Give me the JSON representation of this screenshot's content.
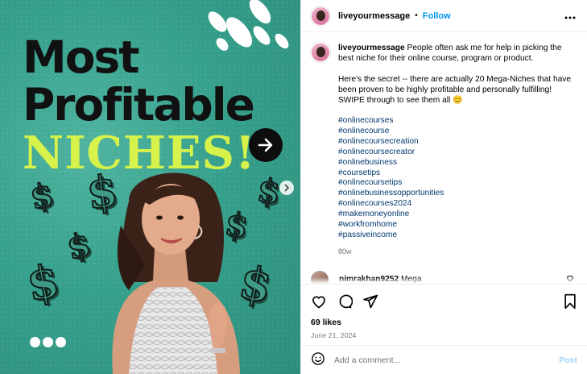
{
  "media": {
    "headline_line1": "Most",
    "headline_line2": "Profitable",
    "headline_line3": "NICHES!",
    "dollar_glyph": "$",
    "colors": {
      "background": "#35a08b",
      "headline_dark": "#111111",
      "headline_accent": "#d7f24a"
    }
  },
  "post": {
    "username": "liveyourmessage",
    "separator": "•",
    "follow_label": "Follow",
    "more_label": "•••",
    "caption_lead": "People often ask me for help in picking the best niche for their online course, program or product.",
    "caption_body": "Here's the secret -- there are actually 20 Mega-Niches that have been proven to be highly profitable and personally fulfilling! SWIPE through to see them all 😊",
    "hashtags": [
      "#onlinecourses",
      "#onlinecourse",
      "#onlinecoursecreation",
      "#onlinecoursecreator",
      "#onlinebusiness",
      "#coursetips",
      "#onlinecoursetips",
      "#onlinebusinessopportunities",
      "#onlinecourses2024",
      "#makemoneyonline",
      "#workfromhome",
      "#passiveincome"
    ],
    "age": "80w",
    "comment": {
      "username": "nimrakhan9252",
      "text": "Mega"
    },
    "likes": "69 likes",
    "date": "June 21, 2024",
    "add_comment_placeholder": "Add a comment...",
    "post_label": "Post",
    "colors": {
      "link": "#00376b",
      "follow": "#0095f6",
      "post_disabled": "#9fd3fb"
    }
  }
}
